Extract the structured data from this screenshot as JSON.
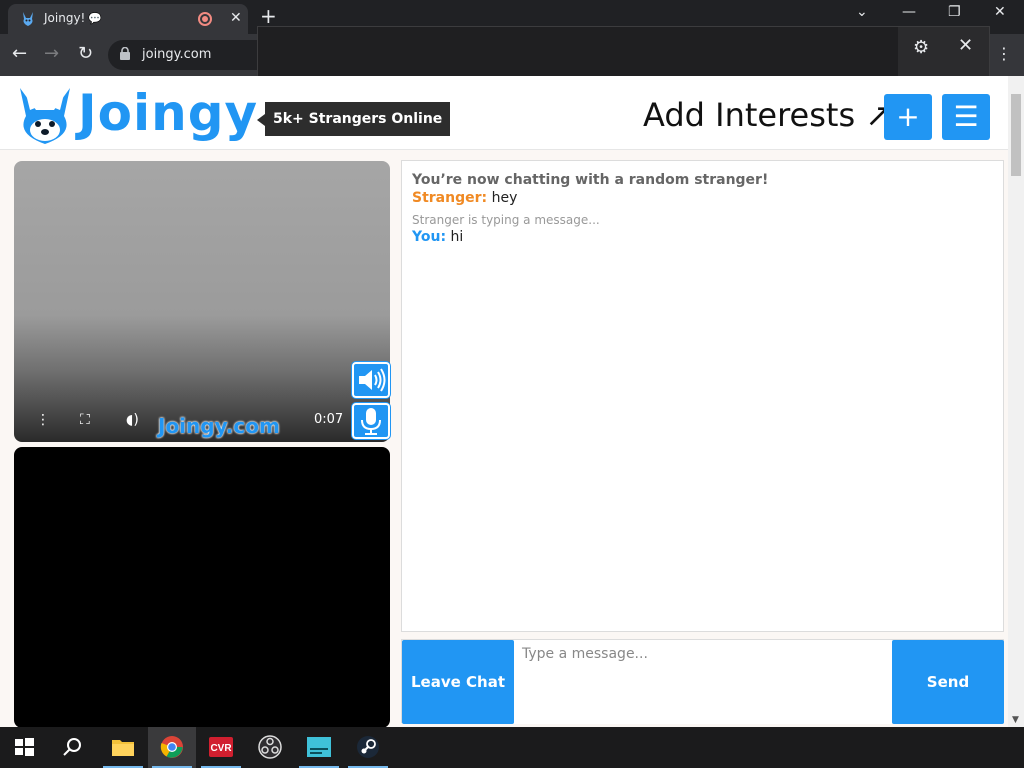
{
  "browser": {
    "tab_title": "Joingy!",
    "tab_chat_glyph": "💬",
    "new_tab": "+",
    "url": "joingy.com",
    "minimize": "—",
    "restore": "❐",
    "close": "✕"
  },
  "header": {
    "logo_text": "Joingy",
    "online_badge": "5k+ Strangers Online",
    "add_interests": "Add Interests ↗",
    "plus_label": "+",
    "menu_label": "☰"
  },
  "video": {
    "watermark": "Joingy.com",
    "time": "0:07"
  },
  "chat": {
    "system_message": "You’re now chatting with a random stranger!",
    "messages": [
      {
        "who": "Stranger",
        "text": "hey"
      },
      {
        "who": "You",
        "text": "hi"
      }
    ],
    "typing_indicator": "Stranger is typing a message..."
  },
  "compose": {
    "leave_label": "Leave Chat",
    "placeholder": "Type a message...",
    "send_label": "Send"
  },
  "colors": {
    "accent": "#2196f3",
    "stranger": "#f08a24"
  },
  "taskbar": {
    "items": [
      "windows-start-icon",
      "search-icon",
      "file-explorer-icon",
      "chrome-icon",
      "cvr-icon",
      "obs-icon",
      "taskbar-app-icon",
      "steam-icon"
    ]
  }
}
